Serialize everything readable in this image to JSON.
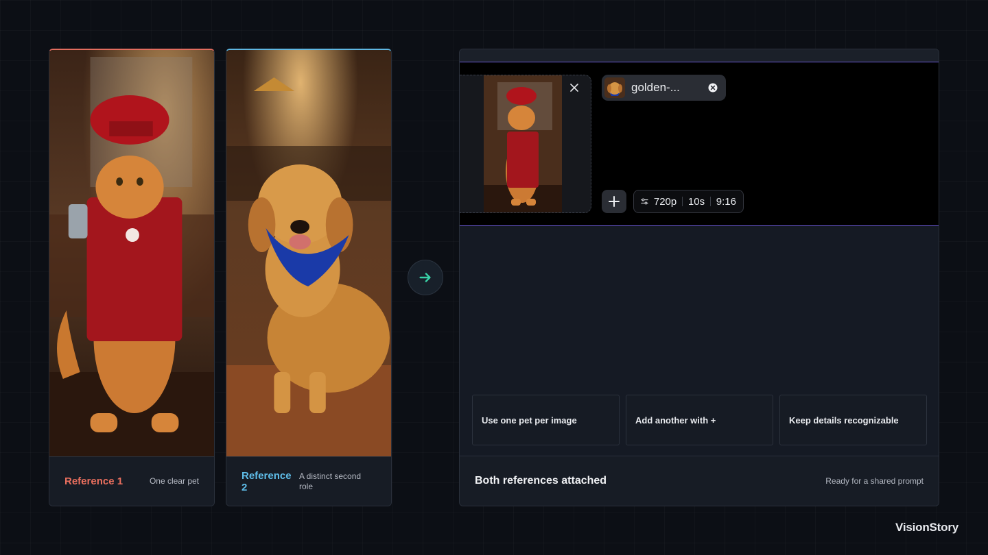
{
  "references": [
    {
      "title": "Reference 1",
      "subtitle": "One clear pet",
      "accent": "#ea6f5e"
    },
    {
      "title": "Reference 2",
      "subtitle": "A distinct second role",
      "accent": "#5fbde9"
    }
  ],
  "arrow": {
    "icon": "arrow-right-icon",
    "color": "#39d3a8"
  },
  "composer": {
    "accent": "#6b5ad6",
    "attachment_chip": {
      "label": "golden-..."
    },
    "settings": {
      "resolution": "720p",
      "duration": "10s",
      "aspect": "9:16"
    }
  },
  "tips": [
    "Use one pet per image",
    "Add another with +",
    "Keep details recognizable"
  ],
  "panel_footer": {
    "title": "Both references attached",
    "status": "Ready for a shared prompt"
  },
  "brand": "VisionStory"
}
